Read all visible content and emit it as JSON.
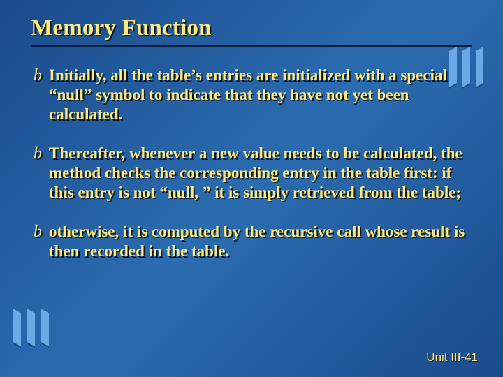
{
  "title": "Memory Function",
  "bullets": [
    "Initially, all the table’s entries are initialized with a special “null” symbol to indicate that they have not yet been calculated.",
    "Thereafter, whenever a new value needs to be calculated, the method checks the corresponding entry in the table first: if this entry is not “null, ” it is simply retrieved from the table;",
    "otherwise, it is computed by the recursive call whose result is then recorded in the table."
  ],
  "bullet_glyph": "b",
  "footer": "Unit III-41"
}
